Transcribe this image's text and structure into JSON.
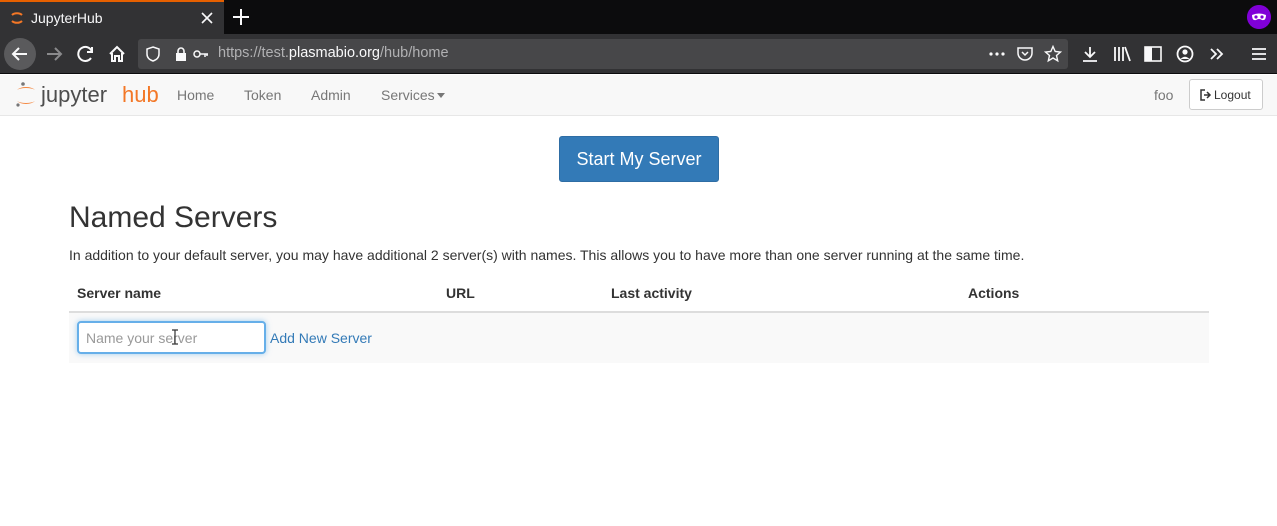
{
  "browser": {
    "tab_title": "JupyterHub",
    "url_prefix": "https://test.",
    "url_host": "plasmabio.org",
    "url_path": "/hub/home",
    "icons": [
      "jupyter-favicon-icon",
      "close-icon",
      "plus-icon",
      "private-mask-icon",
      "back-arrow-icon",
      "forward-arrow-icon",
      "reload-icon",
      "home-icon",
      "shield-icon",
      "lock-icon",
      "key-icon",
      "more-dots-icon",
      "pocket-icon",
      "star-icon",
      "download-icon",
      "library-icon",
      "sidebar-icon",
      "account-icon",
      "overflow-chevron-icon",
      "hamburger-menu-icon"
    ]
  },
  "jupyter_nav": {
    "logo_text_left": "jupyter",
    "logo_text_right": "hub",
    "links": [
      "Home",
      "Token",
      "Admin",
      "Services"
    ],
    "user": "foo",
    "logout_label": "Logout"
  },
  "main": {
    "start_button": "Start My Server",
    "named_heading": "Named Servers",
    "named_description": "In addition to your default server, you may have additional 2 server(s) with names. This allows you to have more than one server running at the same time.",
    "table_headers": [
      "Server name",
      "URL",
      "Last activity",
      "Actions"
    ],
    "server_name_placeholder": "Name your server",
    "add_server_label": "Add New Server"
  },
  "colors": {
    "primary": "#337ab7",
    "jupyter_orange": "#f37726",
    "private_purple": "#8000d7"
  }
}
